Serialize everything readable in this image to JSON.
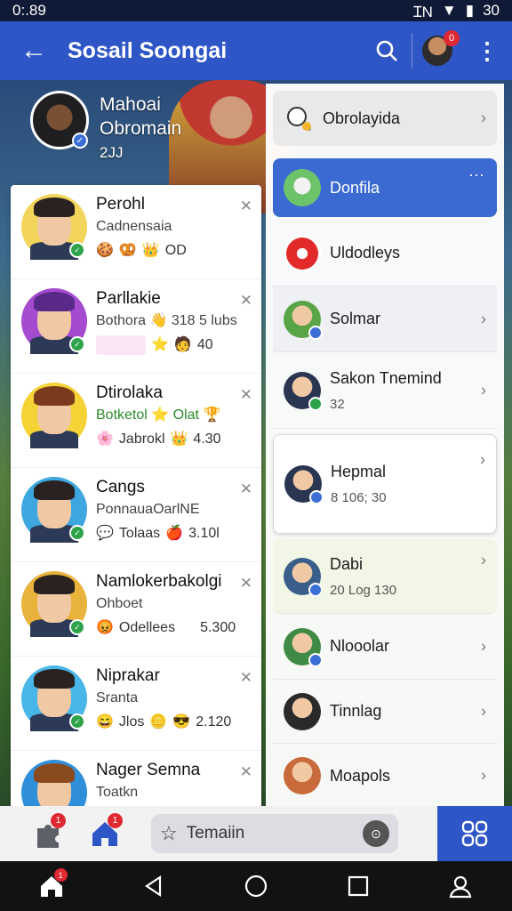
{
  "status_bar": {
    "time": "0:.89",
    "signal": "ꞮN",
    "battery": "30"
  },
  "app_bar": {
    "title": "Sosail Soongai",
    "notification_count": "0"
  },
  "profile": {
    "name": "Mahoai",
    "subname": "Obromain",
    "detail": "2JJ"
  },
  "friends": [
    {
      "name": "Perohl",
      "desc": "Cadnensaia",
      "meta": "OD",
      "desc_green": false
    },
    {
      "name": "Parllakie",
      "desc": "Bothora",
      "desc_extra": "318 5 lubs",
      "meta": "40",
      "desc_green": false
    },
    {
      "name": "Dtirolaka",
      "desc": "Botketol",
      "desc_extra": "Olat",
      "meta_text": "Jabrokl",
      "meta": "4.30",
      "desc_green": true
    },
    {
      "name": "Cangs",
      "desc": "PonnauaOarlNE",
      "meta_text": "Tolaas",
      "meta": "3.10l",
      "desc_green": false
    },
    {
      "name": "Namlokerbakolgi",
      "desc": "Ohboet",
      "meta_text": "Odellees",
      "meta": "5.300",
      "desc_green": false
    },
    {
      "name": "Niprakar",
      "desc": "Sranta",
      "meta_text": "Jlos",
      "meta": "2.120",
      "desc_green": false
    },
    {
      "name": "Nager Semna",
      "desc": "Toatkn",
      "meta_text": "",
      "meta": "",
      "desc_green": false
    }
  ],
  "right_list": [
    {
      "label": "Obrolayida",
      "sub": "",
      "kind": "search"
    },
    {
      "label": "Donfila",
      "sub": "",
      "kind": "active",
      "more": "···"
    },
    {
      "label": "Uldodleys",
      "sub": "",
      "kind": "plain"
    },
    {
      "label": "Solmar",
      "sub": "",
      "kind": "plain"
    },
    {
      "label": "Sakon Tnemind",
      "sub": "32",
      "kind": "plain"
    },
    {
      "label": "Hepmal",
      "sub": "8 106; 30",
      "kind": "card"
    },
    {
      "label": "Dabi",
      "sub": "20 Log 130",
      "kind": "highlight"
    },
    {
      "label": "Nlooolar",
      "sub": "",
      "kind": "plain"
    },
    {
      "label": "Tinnlag",
      "sub": "",
      "kind": "plain"
    },
    {
      "label": "Moapols",
      "sub": "",
      "kind": "plain"
    }
  ],
  "bottom_bar": {
    "search_text": "Temaiin",
    "badge_people": "1",
    "badge_home": "1"
  },
  "nav_bar": {
    "home_badge": "1"
  },
  "colors": {
    "primary": "#2f56c6",
    "badge": "#e02833",
    "online": "#2ea34a"
  }
}
